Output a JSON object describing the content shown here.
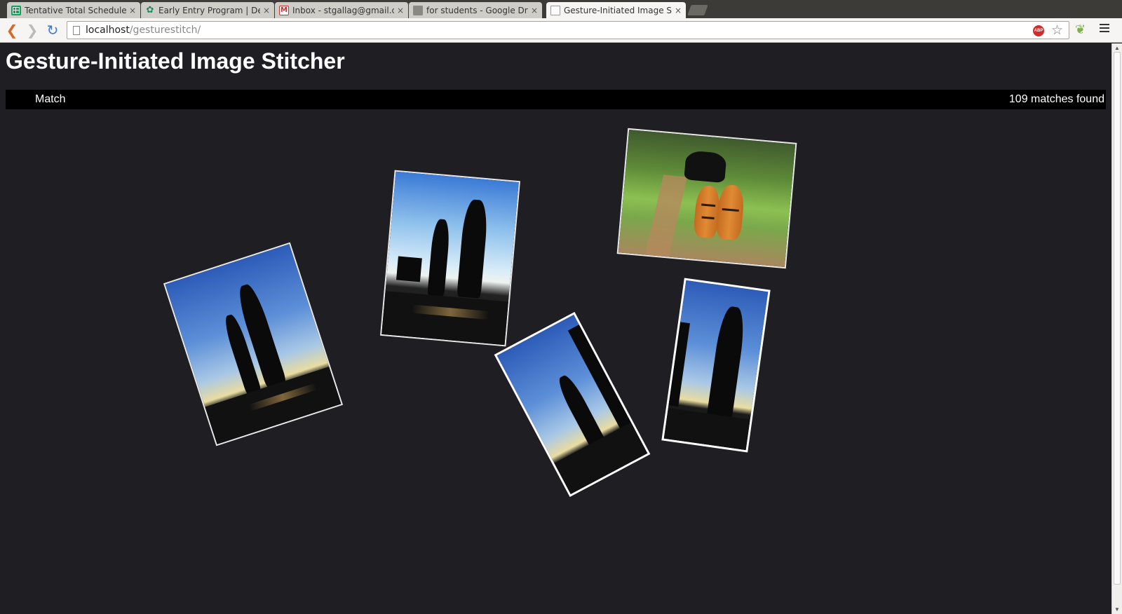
{
  "browser": {
    "tabs": [
      {
        "title": "Tentative Total Schedule",
        "icon": "spreadsheet-icon",
        "active": false
      },
      {
        "title": "Early Entry Program | Dep",
        "icon": "lotus-icon",
        "active": false
      },
      {
        "title": "Inbox - stgallag@gmail.co",
        "icon": "gmail-icon",
        "active": false
      },
      {
        "title": "for students - Google Driv",
        "icon": "folder-icon",
        "active": false
      },
      {
        "title": "Gesture-Initiated Image S",
        "icon": "page-icon",
        "active": true
      }
    ],
    "close_glyph": "×",
    "url_host": "localhost",
    "url_path": "/gesturestitch/",
    "abp_label": "ABP"
  },
  "page": {
    "title": "Gesture-Initiated Image Stitcher",
    "match_label": "Match",
    "match_count": "109 matches found",
    "images": [
      {
        "subject": "silhouette couple at dusk",
        "rotation_deg": -18
      },
      {
        "subject": "silhouette couple against bright sky",
        "rotation_deg": 5
      },
      {
        "subject": "tigers and gaur on forest trail",
        "rotation_deg": 5
      },
      {
        "subject": "silhouette couple cropped",
        "rotation_deg": -28
      },
      {
        "subject": "silhouette man cropped",
        "rotation_deg": 8
      }
    ]
  },
  "colors": {
    "page_background": "#1f1e22",
    "match_bar": "#000000",
    "text": "#ffffff"
  }
}
